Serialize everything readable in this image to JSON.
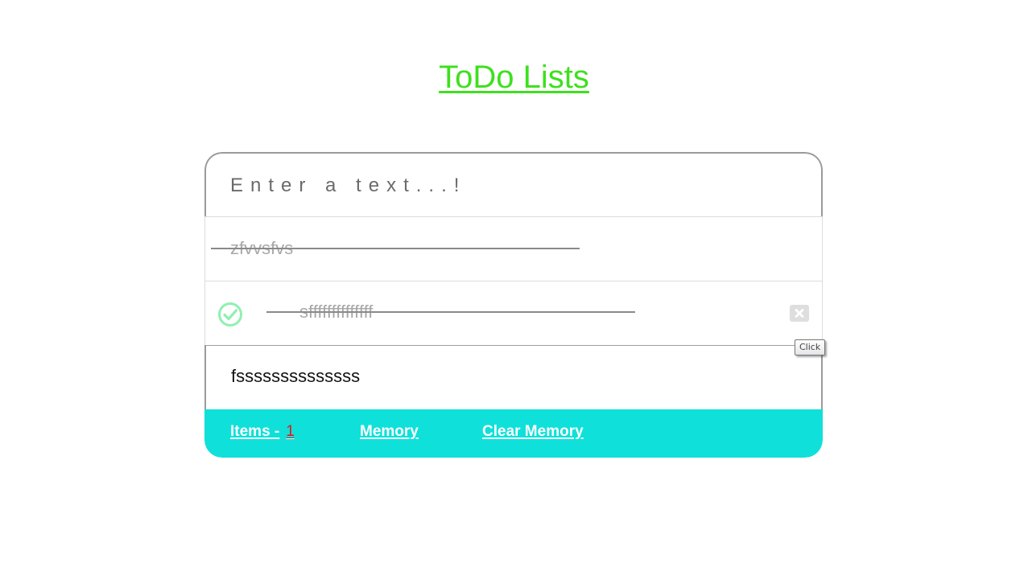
{
  "page": {
    "title": "ToDo Lists"
  },
  "input": {
    "placeholder": "Enter a text...!"
  },
  "todos": [
    {
      "text": "zfvvsfvs",
      "completed": true
    },
    {
      "text": "sffffffffffffff",
      "completed": true
    },
    {
      "text": "fssssssssssssss",
      "completed": false
    }
  ],
  "footer": {
    "items_label": "Items -",
    "items_count": "1",
    "memory_label": "Memory",
    "clear_memory_label": "Clear Memory"
  },
  "tooltip": {
    "text": "Click"
  },
  "icons": {
    "check": "check-circle-icon",
    "delete": "close-box-icon"
  },
  "colors": {
    "title": "#3ee01e",
    "footer_bg": "#0fe0da",
    "count": "#e01818",
    "check": "#8ff0b0"
  }
}
